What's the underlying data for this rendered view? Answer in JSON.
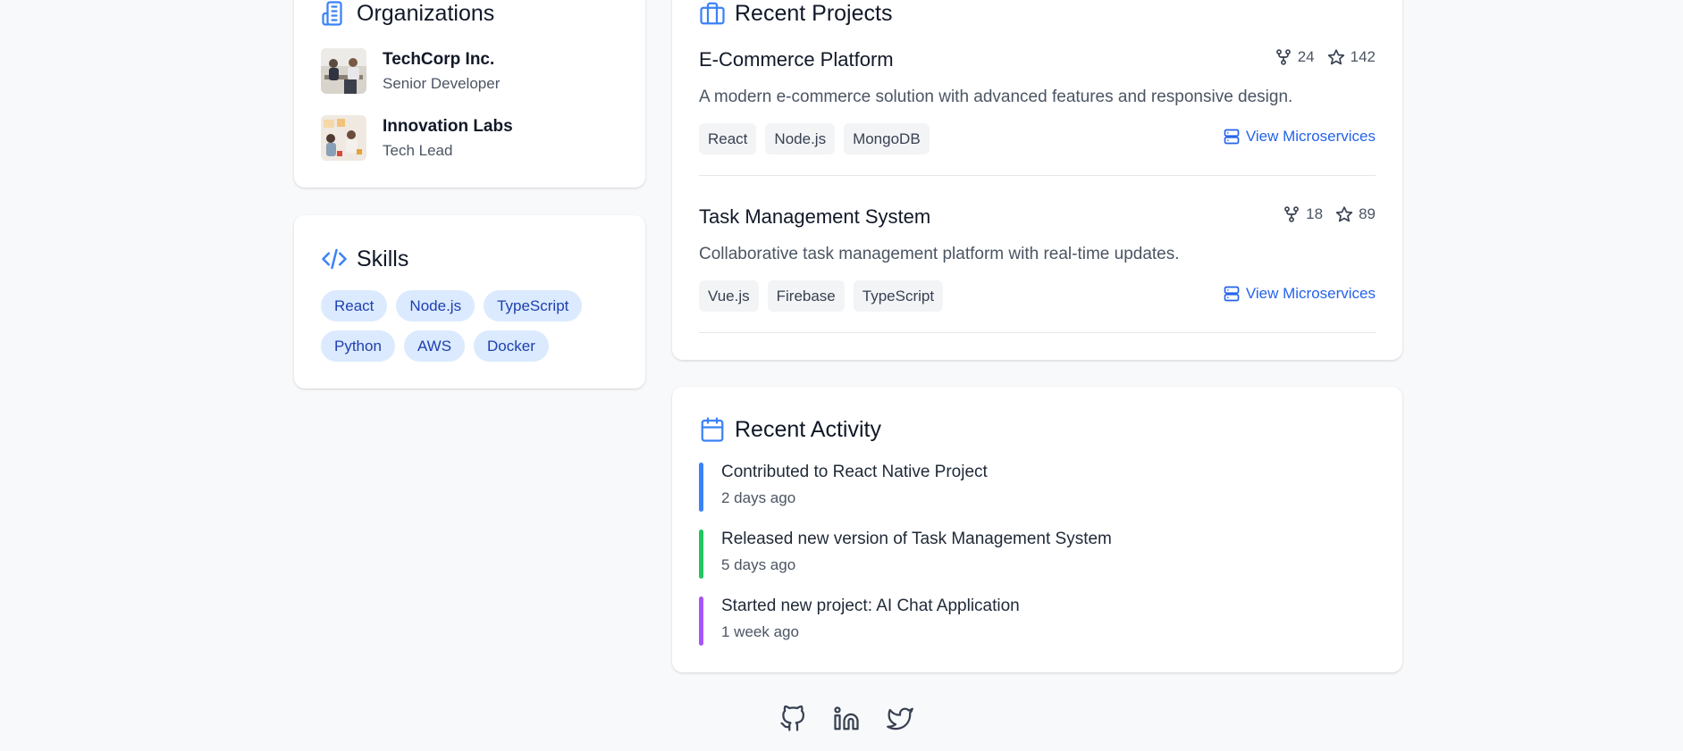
{
  "organizations": {
    "title": "Organizations",
    "items": [
      {
        "name": "TechCorp Inc.",
        "role": "Senior Developer"
      },
      {
        "name": "Innovation Labs",
        "role": "Tech Lead"
      }
    ]
  },
  "skills": {
    "title": "Skills",
    "items": [
      "React",
      "Node.js",
      "TypeScript",
      "Python",
      "AWS",
      "Docker"
    ]
  },
  "projects": {
    "title": "Recent Projects",
    "items": [
      {
        "name": "E-Commerce Platform",
        "forks": "24",
        "stars": "142",
        "description": "A modern e-commerce solution with advanced features and responsive design.",
        "tags": [
          "React",
          "Node.js",
          "MongoDB"
        ],
        "link_label": "View Microservices"
      },
      {
        "name": "Task Management System",
        "forks": "18",
        "stars": "89",
        "description": "Collaborative task management platform with real-time updates.",
        "tags": [
          "Vue.js",
          "Firebase",
          "TypeScript"
        ],
        "link_label": "View Microservices"
      }
    ]
  },
  "activity": {
    "title": "Recent Activity",
    "items": [
      {
        "text": "Contributed to React Native Project",
        "time": "2 days ago",
        "color": "#3b82f6"
      },
      {
        "text": "Released new version of Task Management System",
        "time": "5 days ago",
        "color": "#22c55e"
      },
      {
        "text": "Started new project: AI Chat Application",
        "time": "1 week ago",
        "color": "#a855f7"
      }
    ]
  },
  "social": {
    "icons": [
      "github-icon",
      "linkedin-icon",
      "twitter-icon"
    ]
  },
  "colors": {
    "accent": "#2563eb",
    "skill_bg": "#dbeafe",
    "skill_text": "#1e40af",
    "tag_bg": "#f3f4f6"
  }
}
